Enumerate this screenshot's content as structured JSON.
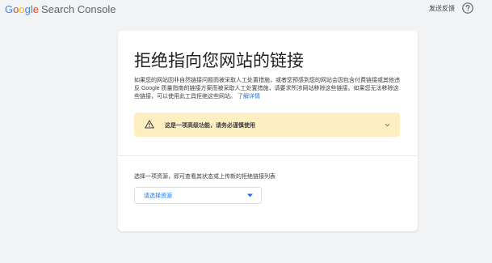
{
  "header": {
    "logo_letters": [
      "G",
      "o",
      "o",
      "g",
      "l",
      "e"
    ],
    "product_name": "Search Console",
    "feedback_label": "发送反馈",
    "help_icon": "help-circle-icon"
  },
  "main": {
    "title": "拒绝指向您网站的链接",
    "description": "如果您的网站因非自然链接问题而被采取人工处置措施，或者您预感到您的网站会因包含付费链接或其他违反 Google 质量指南的链接方案而被采取人工处置措施，请要求所涉网站移除这些链接。如果您无法移除这些链接，可以使用此工具拒绝这些网站。",
    "learn_more_link": "了解详情",
    "warning": {
      "text": "这是一项高级功能，请务必谨慎使用",
      "icon": "warning-triangle-icon",
      "expand_icon": "chevron-down-icon",
      "background": "#feefc3"
    },
    "select_label": "选择一项资源，即可查看其状态或上传新的拒绝链接列表",
    "dropdown": {
      "placeholder": "请选择资源",
      "icon": "dropdown-arrow-icon",
      "accent": "#1a73e8"
    }
  }
}
